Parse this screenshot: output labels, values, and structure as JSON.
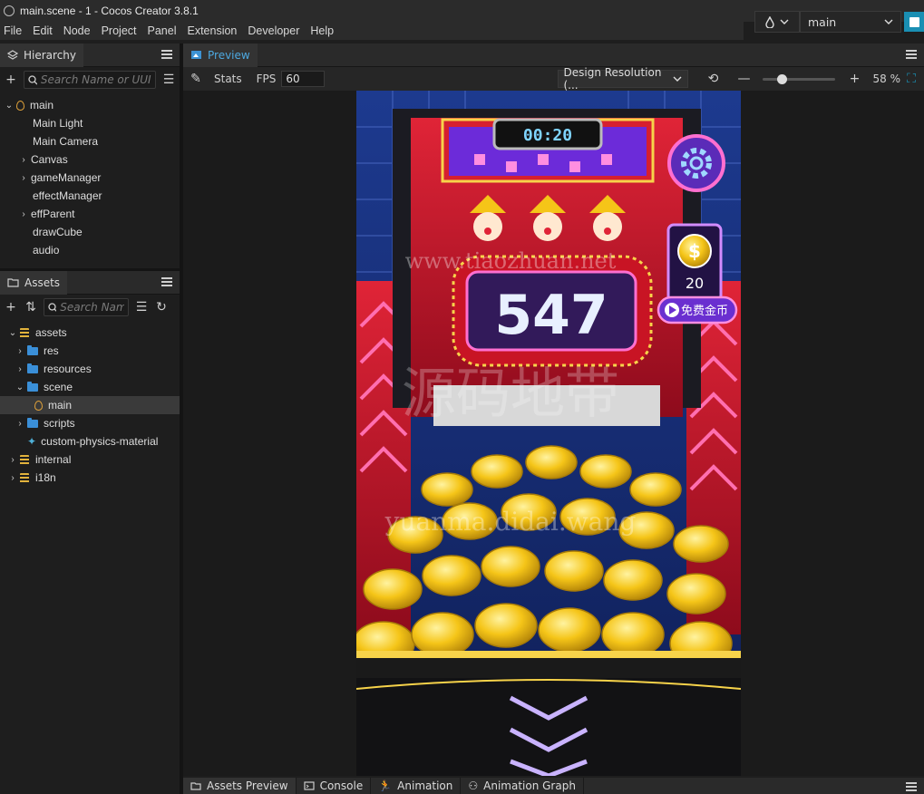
{
  "window": {
    "title": "main.scene - 1 - Cocos Creator 3.8.1"
  },
  "menu": [
    "File",
    "Edit",
    "Node",
    "Project",
    "Panel",
    "Extension",
    "Developer",
    "Help"
  ],
  "topbar": {
    "scene": "main"
  },
  "hierarchy": {
    "tab": "Hierarchy",
    "search_placeholder": "Search Name or UUID",
    "items": [
      {
        "label": "main"
      },
      {
        "label": "Main Light"
      },
      {
        "label": "Main Camera"
      },
      {
        "label": "Canvas"
      },
      {
        "label": "gameManager"
      },
      {
        "label": "effectManager"
      },
      {
        "label": "effParent"
      },
      {
        "label": "drawCube"
      },
      {
        "label": "audio"
      }
    ]
  },
  "assets": {
    "tab": "Assets",
    "search_placeholder": "Search Name",
    "items": [
      {
        "label": "assets"
      },
      {
        "label": "res"
      },
      {
        "label": "resources"
      },
      {
        "label": "scene"
      },
      {
        "label": "main"
      },
      {
        "label": "scripts"
      },
      {
        "label": "custom-physics-material"
      },
      {
        "label": "internal"
      },
      {
        "label": "i18n"
      }
    ]
  },
  "preview": {
    "tab": "Preview",
    "stats_label": "Stats",
    "fps_label": "FPS",
    "fps_value": "60",
    "resolution": "Design Resolution (...",
    "zoom": "58 %"
  },
  "game": {
    "timer": "00:20",
    "score": "547",
    "coins": "20",
    "free_coins_label": "免费金币",
    "watermark_1": "www.tiaozhuan.net",
    "watermark_2": "源码地带",
    "watermark_3": "yuanma.didai.wang"
  },
  "bottom_tabs": [
    "Assets Preview",
    "Console",
    "Animation",
    "Animation Graph"
  ],
  "colors": {
    "accent": "#1a8fb3",
    "folder": "#3a8fd8",
    "scene_icon": "#e0a23a",
    "machine_red": "#c8102e",
    "coin_gold": "#f5c518"
  }
}
